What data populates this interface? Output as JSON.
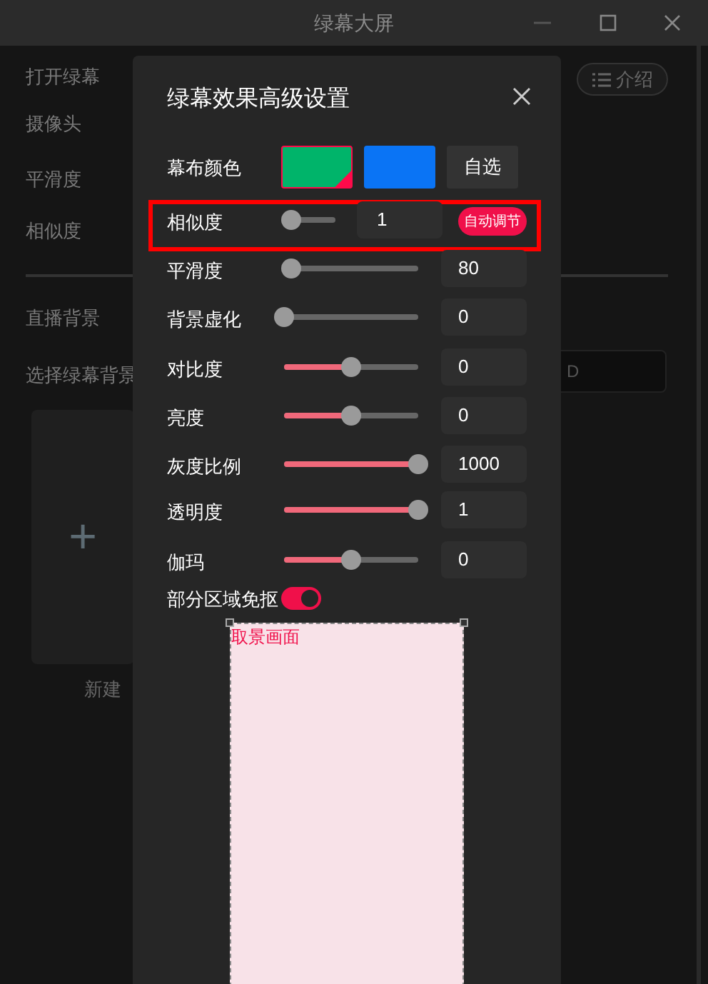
{
  "window": {
    "title": "绿幕大屏"
  },
  "background": {
    "items": [
      "打开绿幕",
      "摄像头",
      "平滑度",
      "相似度"
    ],
    "section": "直播背景",
    "select_label": "选择绿幕背景",
    "field_text": "D",
    "intro_button": "介绍",
    "new_card": {
      "icon": "+",
      "label": "新建"
    }
  },
  "dialog": {
    "title": "绿幕效果高级设置",
    "color_row": {
      "label": "幕布颜色",
      "swatches": [
        {
          "color": "#00b46a",
          "selected": true
        },
        {
          "color": "#0a74f5",
          "selected": false
        }
      ],
      "custom_button": "自选"
    },
    "similarity": {
      "label": "相似度",
      "level": 0.1,
      "value": "1",
      "highlighted": true,
      "auto_button": "自动调节"
    },
    "sliders": [
      {
        "label": "平滑度",
        "level": 0.05,
        "value": "80"
      },
      {
        "label": "背景虚化",
        "level": 0,
        "value": "0"
      },
      {
        "label": "对比度",
        "level": 0.5,
        "value": "0"
      },
      {
        "label": "亮度",
        "level": 0.5,
        "value": "0"
      },
      {
        "label": "灰度比例",
        "level": 1,
        "value": "1000"
      },
      {
        "label": "透明度",
        "level": 1,
        "value": "1"
      },
      {
        "label": "伽玛",
        "level": 0.5,
        "value": "0"
      }
    ],
    "region_toggle": {
      "label": "部分区域免抠",
      "on": true
    },
    "preview": {
      "label": "取景画面"
    }
  }
}
